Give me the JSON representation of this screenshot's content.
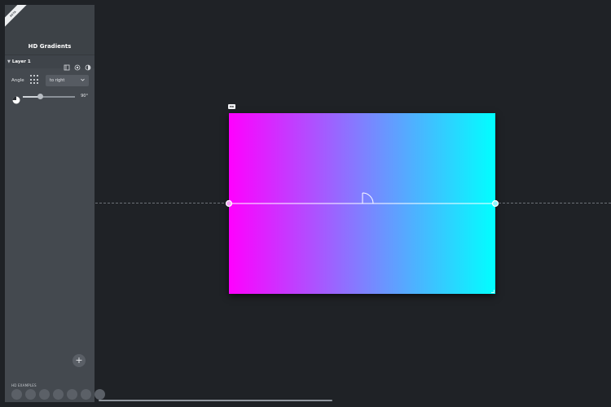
{
  "app": {
    "title": "HD Gradients",
    "ribbon": "BETA"
  },
  "layer": {
    "name": "Layer 1",
    "icons": [
      "duplicate-layer-icon",
      "circle-shape-icon",
      "half-circle-icon"
    ]
  },
  "angle_control": {
    "label": "Angle",
    "direction_value": "to right",
    "slider_value_text": "90°",
    "slider_fraction": 0.33
  },
  "canvas": {
    "size_tag": "HD",
    "gradient_colors": [
      "#ff00ff",
      "#00ffff"
    ],
    "gradient_direction": "to right"
  },
  "examples": {
    "label": "HD EXAMPLES",
    "count": 7
  },
  "colors": {
    "background": "#1f2226",
    "sidebar": "#44494f",
    "accent_handle": "#ffffff"
  }
}
